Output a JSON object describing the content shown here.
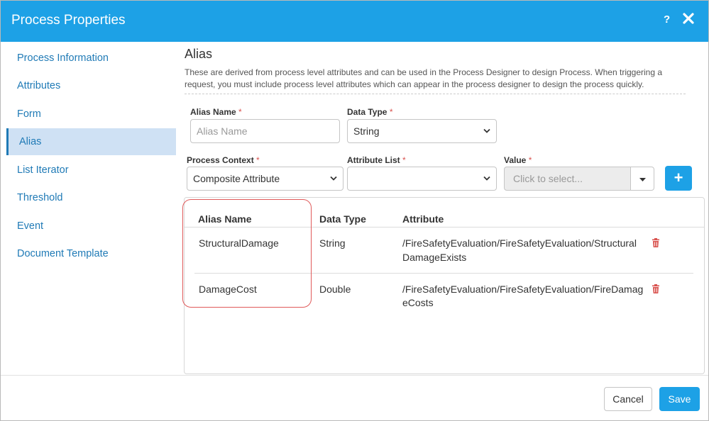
{
  "dialog": {
    "title": "Process Properties",
    "help_label": "?",
    "accent_color": "#1da1e6"
  },
  "sidebar": {
    "items": [
      {
        "label": "Process Information"
      },
      {
        "label": "Attributes"
      },
      {
        "label": "Form"
      },
      {
        "label": "Alias",
        "active": true
      },
      {
        "label": "List Iterator"
      },
      {
        "label": "Threshold"
      },
      {
        "label": "Event"
      },
      {
        "label": "Document Template"
      }
    ]
  },
  "section": {
    "title": "Alias",
    "description": "These are derived from process level attributes and can be used in the Process Designer to design Process. When triggering a request, you must include process level attributes which can appear in the process designer to design the process quickly."
  },
  "form": {
    "required_mark": "*",
    "alias_name": {
      "label": "Alias Name",
      "placeholder": "Alias Name",
      "value": ""
    },
    "data_type": {
      "label": "Data Type",
      "value": "String"
    },
    "process_context": {
      "label": "Process Context",
      "value": "Composite Attribute"
    },
    "attribute_list": {
      "label": "Attribute List",
      "value": ""
    },
    "value": {
      "label": "Value",
      "placeholder": "Click to select..."
    },
    "add_label": "+"
  },
  "table": {
    "columns": [
      "Alias Name",
      "Data Type",
      "Attribute"
    ],
    "rows": [
      {
        "alias": "StructuralDamage",
        "type": "String",
        "attr_line1": "/FireSafetyEvaluation/FireSafetyEvaluation/Structural",
        "attr_line2": "DamageExists"
      },
      {
        "alias": "DamageCost",
        "type": "Double",
        "attr_line1": "/FireSafetyEvaluation/FireSafetyEvaluation/FireDamag",
        "attr_line2": "eCosts"
      }
    ]
  },
  "footer": {
    "cancel_label": "Cancel",
    "save_label": "Save"
  }
}
